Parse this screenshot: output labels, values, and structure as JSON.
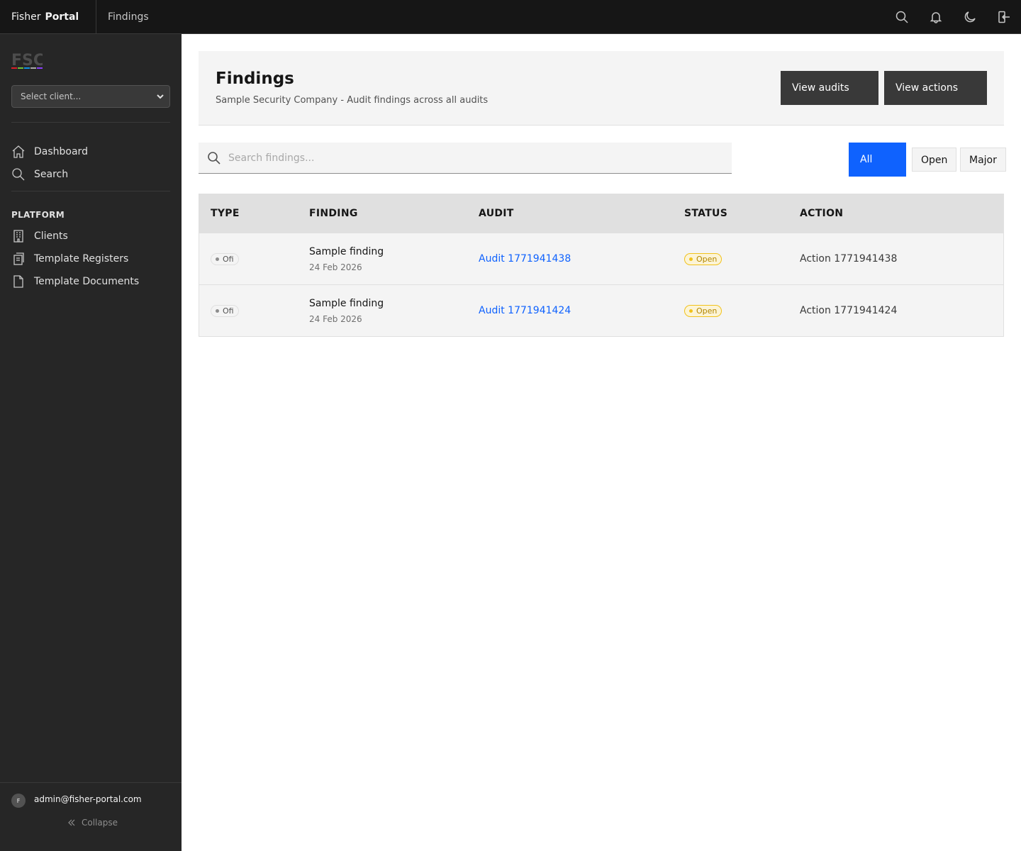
{
  "topbar": {
    "brand_first": "Fisher",
    "brand_second": "Portal",
    "breadcrumb": "Findings",
    "icons": [
      "search-icon",
      "bell-icon",
      "moon-icon",
      "logout-icon"
    ]
  },
  "sidebar": {
    "client_select": "Select client...",
    "items": [
      {
        "label": "Dashboard",
        "icon": "home-icon"
      },
      {
        "label": "Search",
        "icon": "search-icon"
      }
    ],
    "section": "PLATFORM",
    "platform_items": [
      {
        "label": "Clients",
        "icon": "building-icon"
      },
      {
        "label": "Template Registers",
        "icon": "copy-icon"
      },
      {
        "label": "Template Documents",
        "icon": "document-icon"
      }
    ],
    "user_initial": "F",
    "user_email": "admin@fisher-portal.com",
    "collapse": "Collapse",
    "logo_colors": [
      "#da1e28",
      "#6fbf3a",
      "#1192e8",
      "#a8a8a8",
      "#8a3ffc"
    ]
  },
  "header": {
    "title": "Findings",
    "subtitle": "Sample Security Company - Audit findings across all audits",
    "view_audits": "View audits",
    "view_actions": "View actions"
  },
  "search": {
    "placeholder": "Search findings..."
  },
  "filters": {
    "all": "All",
    "open": "Open",
    "major": "Major",
    "active": "All"
  },
  "table": {
    "columns": [
      "TYPE",
      "FINDING",
      "AUDIT",
      "STATUS",
      "ACTION"
    ],
    "rows": [
      {
        "type": "Ofi",
        "finding": "Sample finding",
        "date": "24 Feb 2026",
        "audit": "Audit 1771941438",
        "status": "Open",
        "action": "Action 1771941438"
      },
      {
        "type": "Ofi",
        "finding": "Sample finding",
        "date": "24 Feb 2026",
        "audit": "Audit 1771941424",
        "status": "Open",
        "action": "Action 1771941424"
      }
    ]
  },
  "colors": {
    "accent": "#0f62fe",
    "link": "#0f62fe",
    "status_open": "#f1c21b"
  }
}
